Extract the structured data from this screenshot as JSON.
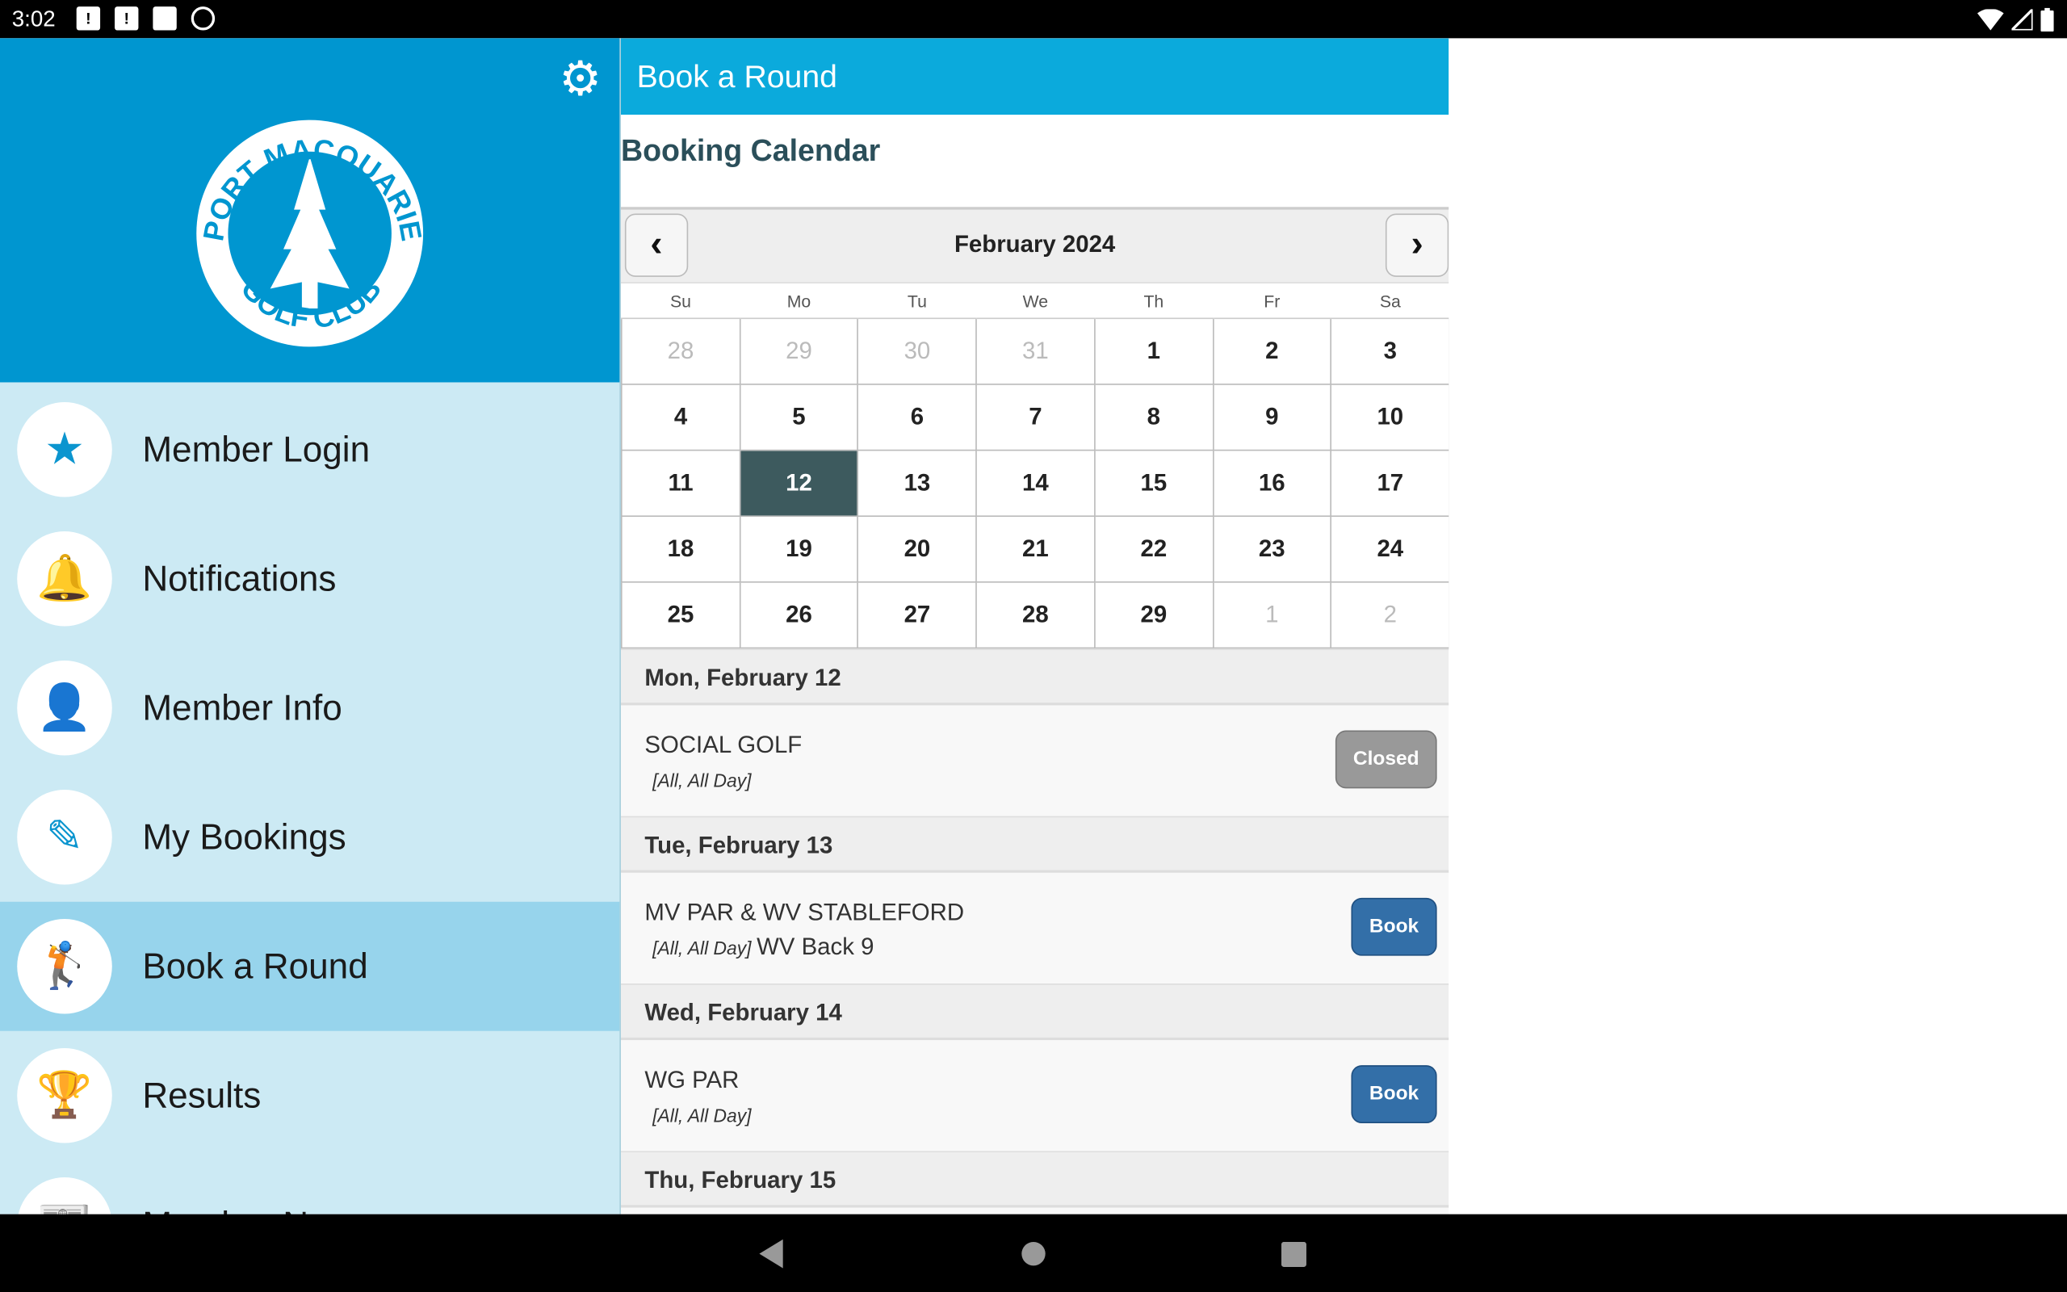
{
  "status": {
    "time": "3:02"
  },
  "sidebar": {
    "logo_text": "PORT MACQUARIE GOLF CLUB",
    "items": [
      {
        "label": "Member Login",
        "icon": "map-pin-star-icon",
        "glyph": "★"
      },
      {
        "label": "Notifications",
        "icon": "bell-icon",
        "glyph": "🔔"
      },
      {
        "label": "Member Info",
        "icon": "person-icon",
        "glyph": "👤"
      },
      {
        "label": "My Bookings",
        "icon": "edit-icon",
        "glyph": "✎"
      },
      {
        "label": "Book a Round",
        "icon": "golfer-icon",
        "glyph": "🏌",
        "active": true
      },
      {
        "label": "Results",
        "icon": "trophy-icon",
        "glyph": "🏆"
      },
      {
        "label": "Member News",
        "icon": "news-icon",
        "glyph": "📰"
      }
    ]
  },
  "header": {
    "title": "Book a Round"
  },
  "calendar": {
    "heading": "Booking Calendar",
    "month": "February 2024",
    "accent": "#3D5A5E",
    "weekdays": [
      "Su",
      "Mo",
      "Tu",
      "We",
      "Th",
      "Fr",
      "Sa"
    ],
    "weeks": [
      [
        "28",
        "29",
        "30",
        "31",
        "1",
        "2",
        "3"
      ],
      [
        "4",
        "5",
        "6",
        "7",
        "8",
        "9",
        "10"
      ],
      [
        "11",
        "12",
        "13",
        "14",
        "15",
        "16",
        "17"
      ],
      [
        "18",
        "19",
        "20",
        "21",
        "22",
        "23",
        "24"
      ],
      [
        "25",
        "26",
        "27",
        "28",
        "29",
        "1",
        "2"
      ]
    ],
    "selected": "12"
  },
  "days": [
    {
      "date": "Mon, February 12",
      "events": [
        {
          "name": "SOCIAL GOLF",
          "sub": "[All, All Day]",
          "extra": "",
          "button": "Closed",
          "type": "closed"
        }
      ]
    },
    {
      "date": "Tue, February 13",
      "events": [
        {
          "name": "MV PAR & WV STABLEFORD",
          "sub": "[All, All Day]",
          "extra": "WV Back 9",
          "button": "Book",
          "type": "book"
        }
      ]
    },
    {
      "date": "Wed, February 14",
      "events": [
        {
          "name": "WG PAR",
          "sub": "[All, All Day]",
          "extra": "",
          "button": "Book",
          "type": "book"
        }
      ]
    },
    {
      "date": "Thu, February 15",
      "events": [
        {
          "name": "",
          "sub": "",
          "extra": "",
          "button": "",
          "type": "book"
        }
      ]
    }
  ]
}
